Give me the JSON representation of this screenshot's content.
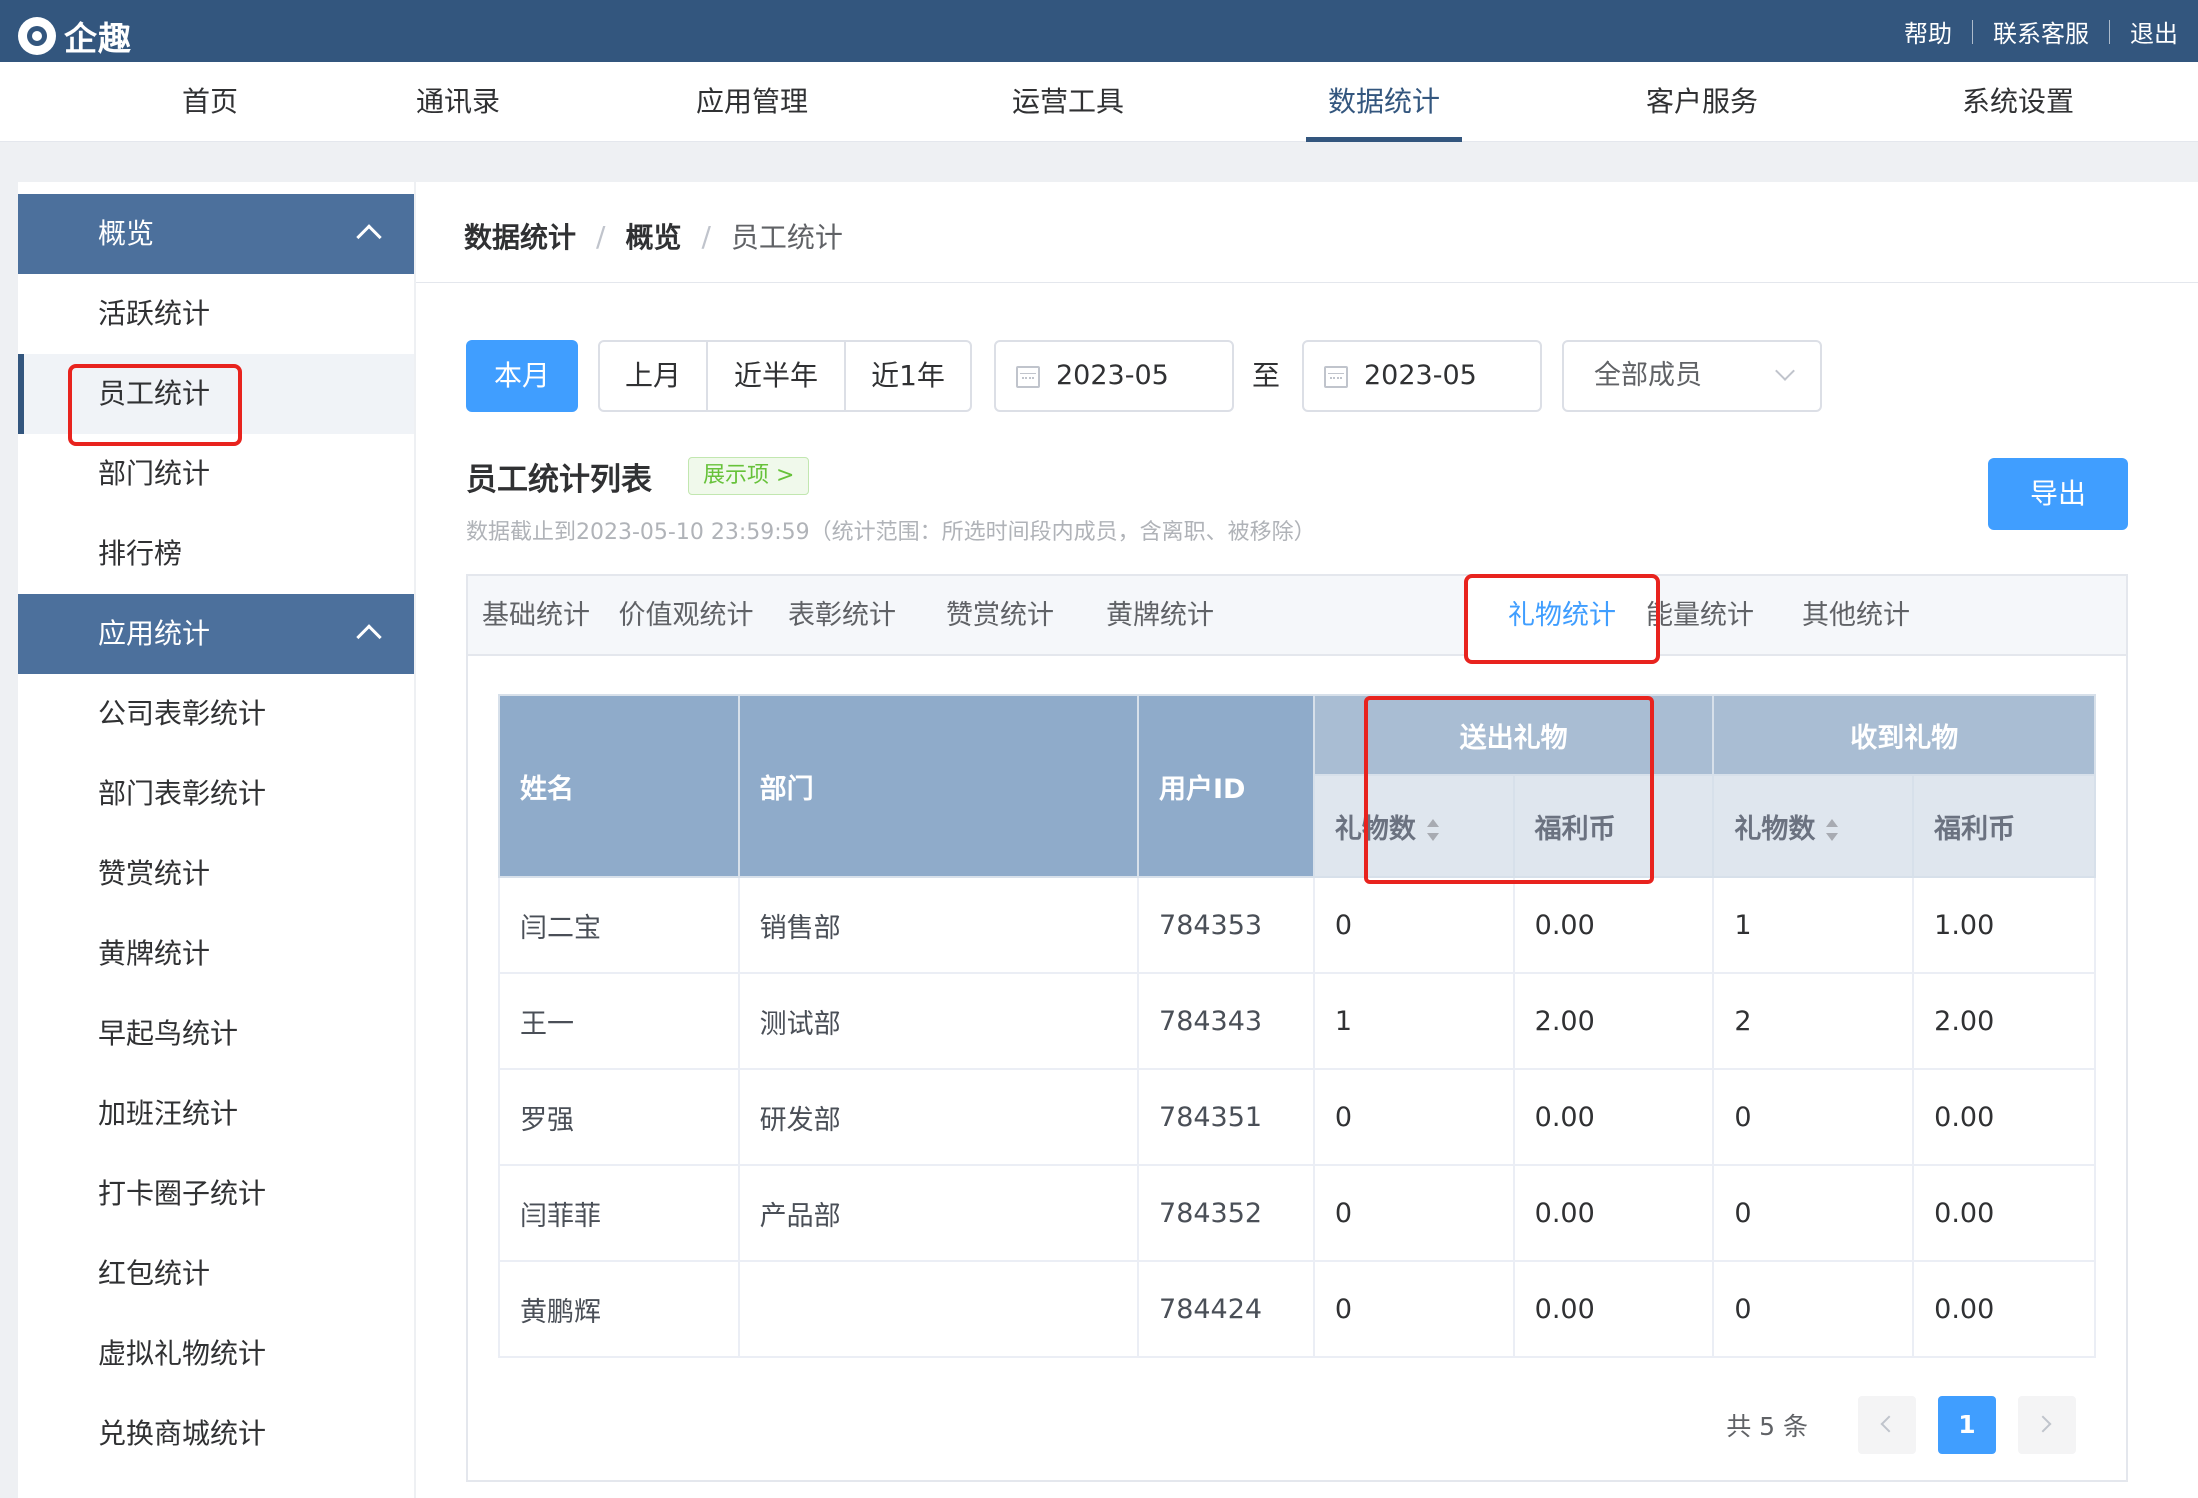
{
  "app": {
    "name": "企趣"
  },
  "top_links": [
    "帮助",
    "联系客服",
    "退出"
  ],
  "main_nav": [
    {
      "label": "首页",
      "active": false
    },
    {
      "label": "通讯录",
      "active": false
    },
    {
      "label": "应用管理",
      "active": false
    },
    {
      "label": "运营工具",
      "active": false
    },
    {
      "label": "数据统计",
      "active": true
    },
    {
      "label": "客户服务",
      "active": false
    },
    {
      "label": "系统设置",
      "active": false
    }
  ],
  "sidebar": {
    "group1": {
      "title": "概览",
      "items": [
        "活跃统计",
        "员工统计",
        "部门统计",
        "排行榜"
      ],
      "active_index": 1
    },
    "group2": {
      "title": "应用统计",
      "items": [
        "公司表彰统计",
        "部门表彰统计",
        "赞赏统计",
        "黄牌统计",
        "早起鸟统计",
        "加班汪统计",
        "打卡圈子统计",
        "红包统计",
        "虚拟礼物统计",
        "兑换商城统计"
      ]
    }
  },
  "breadcrumb": [
    "数据统计",
    "概览",
    "员工统计"
  ],
  "filters": {
    "current_month": "本月",
    "ranges": [
      "上月",
      "近半年",
      "近1年"
    ],
    "start_date": "2023-05",
    "to_label": "至",
    "end_date": "2023-05",
    "member_select": "全部成员"
  },
  "list": {
    "title": "员工统计列表",
    "show_tag": "展示项 >",
    "export_label": "导出",
    "note": "数据截止到2023-05-10 23:59:59（统计范围：所选时间段内成员，含离职、被移除）"
  },
  "tabs": [
    "基础统计",
    "价值观统计",
    "表彰统计",
    "赞赏统计",
    "黄牌统计",
    "礼物统计",
    "能量统计",
    "其他统计"
  ],
  "active_tab": 5,
  "table": {
    "headers": {
      "name": "姓名",
      "dept": "部门",
      "user_id": "用户ID",
      "sent_group": "送出礼物",
      "received_group": "收到礼物",
      "gift_count": "礼物数",
      "coins": "福利币"
    },
    "rows": [
      {
        "name": "闫二宝",
        "dept": "销售部",
        "user_id": "784353",
        "sent_count": "0",
        "sent_coins": "0.00",
        "recv_count": "1",
        "recv_coins": "1.00"
      },
      {
        "name": "王一",
        "dept": "测试部",
        "user_id": "784343",
        "sent_count": "1",
        "sent_coins": "2.00",
        "recv_count": "2",
        "recv_coins": "2.00"
      },
      {
        "name": "罗强",
        "dept": "研发部",
        "user_id": "784351",
        "sent_count": "0",
        "sent_coins": "0.00",
        "recv_count": "0",
        "recv_coins": "0.00"
      },
      {
        "name": "闫菲菲",
        "dept": "产品部",
        "user_id": "784352",
        "sent_count": "0",
        "sent_coins": "0.00",
        "recv_count": "0",
        "recv_coins": "0.00"
      },
      {
        "name": "黄鹏辉",
        "dept": "",
        "user_id": "784424",
        "sent_count": "0",
        "sent_coins": "0.00",
        "recv_count": "0",
        "recv_coins": "0.00"
      }
    ]
  },
  "pagination": {
    "total_text": "共 5 条",
    "current_page": "1"
  },
  "colors": {
    "topbar": "#33567e",
    "primary": "#409eff",
    "sidebar_head": "#4c709c",
    "highlight": "#e8231e"
  }
}
